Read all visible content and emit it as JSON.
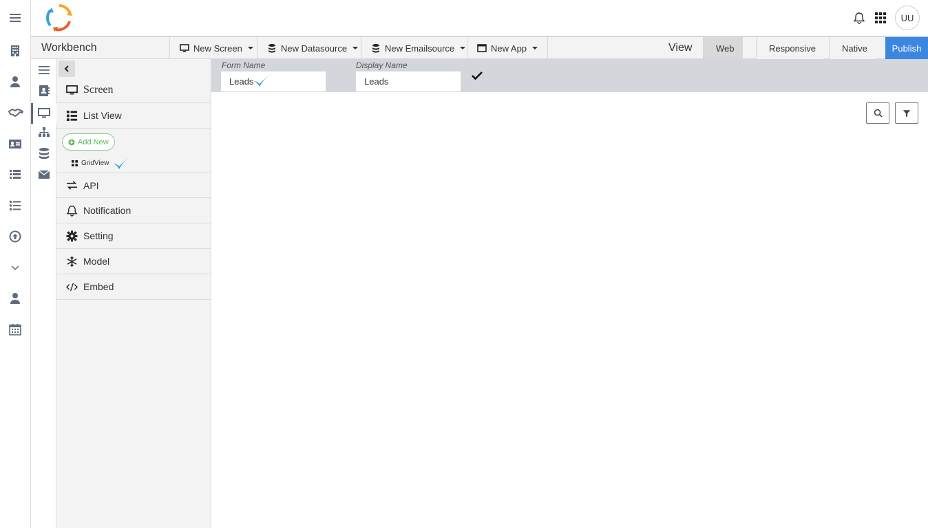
{
  "header": {
    "avatar_initials": "UU"
  },
  "toolbar": {
    "title": "Workbench",
    "new_screen": "New Screen",
    "new_datasource": "New Datasource",
    "new_emailsource": "New Emailsource",
    "new_app": "New App",
    "view_label": "View",
    "view_web": "Web",
    "view_responsive": "Responsive",
    "view_native": "Native",
    "publish": "Publish"
  },
  "panel": {
    "screen": "Screen",
    "list_view": "List View",
    "add_new": "Add New",
    "gridview": "GridView",
    "api": "API",
    "notification": "Notification",
    "setting": "Setting",
    "model": "Model",
    "embed": "Embed"
  },
  "form": {
    "form_name_label": "Form Name",
    "form_name_value": "Leads",
    "display_name_label": "Display Name",
    "display_name_value": "Leads"
  },
  "colors": {
    "accent": "#3b86e0",
    "formbar": "#d3d7dc",
    "add_new": "#5cb85c",
    "check_blue": "#2b9ee0"
  }
}
